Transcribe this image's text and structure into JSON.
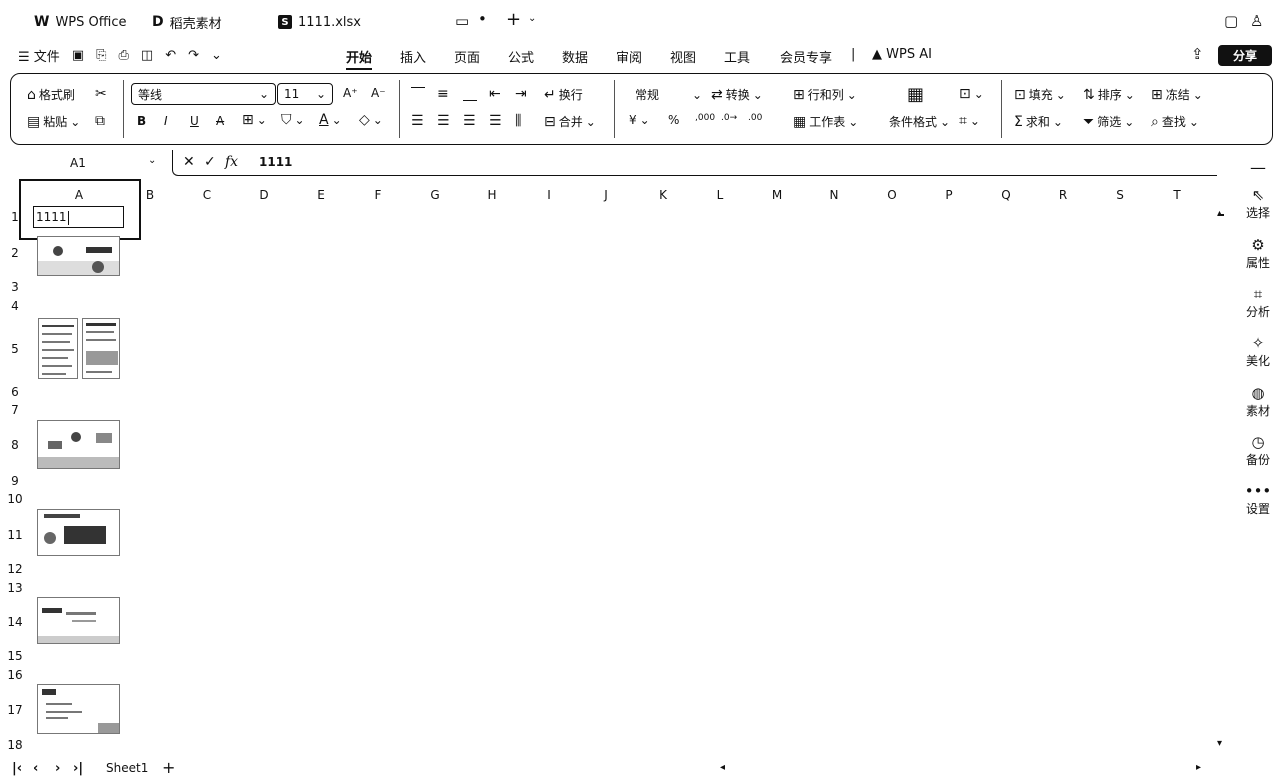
{
  "tabs": {
    "wps": "WPS Office",
    "daoke": "稻壳素材",
    "file": "1111.xlsx"
  },
  "menu": {
    "file": "文件",
    "items": [
      "开始",
      "插入",
      "页面",
      "公式",
      "数据",
      "审阅",
      "视图",
      "工具",
      "会员专享"
    ],
    "wps_ai": "WPS AI",
    "share": "分享"
  },
  "ribbon": {
    "format_painter": "格式刷",
    "paste": "粘贴",
    "font_name": "等线",
    "font_size": "11",
    "bold": "B",
    "italic": "I",
    "underline": "U",
    "strike": "A",
    "wrap": "换行",
    "merge": "合并",
    "number_format": "常规",
    "convert": "转换",
    "row_col": "行和列",
    "worksheet": "工作表",
    "cond_format": "条件格式",
    "fill": "填充",
    "sort": "排序",
    "freeze": "冻结",
    "sum": "求和",
    "filter": "筛选",
    "find": "查找",
    "currency": "¥",
    "percent": "%"
  },
  "formula_bar": {
    "name_box": "A1",
    "content": "1111"
  },
  "grid": {
    "columns": [
      "A",
      "B",
      "C",
      "D",
      "E",
      "F",
      "G",
      "H",
      "I",
      "J",
      "K",
      "L",
      "M",
      "N",
      "O",
      "P",
      "Q",
      "R",
      "S",
      "T"
    ],
    "rows": [
      "1",
      "2",
      "3",
      "4",
      "5",
      "6",
      "7",
      "8",
      "9",
      "10",
      "11",
      "12",
      "13",
      "14",
      "15",
      "16",
      "17",
      "18"
    ],
    "a1_value": "1111"
  },
  "sidebar": [
    "选择",
    "属性",
    "分析",
    "美化",
    "素材",
    "备份",
    "设置"
  ],
  "sheets": {
    "active": "Sheet1",
    "add": "+"
  }
}
